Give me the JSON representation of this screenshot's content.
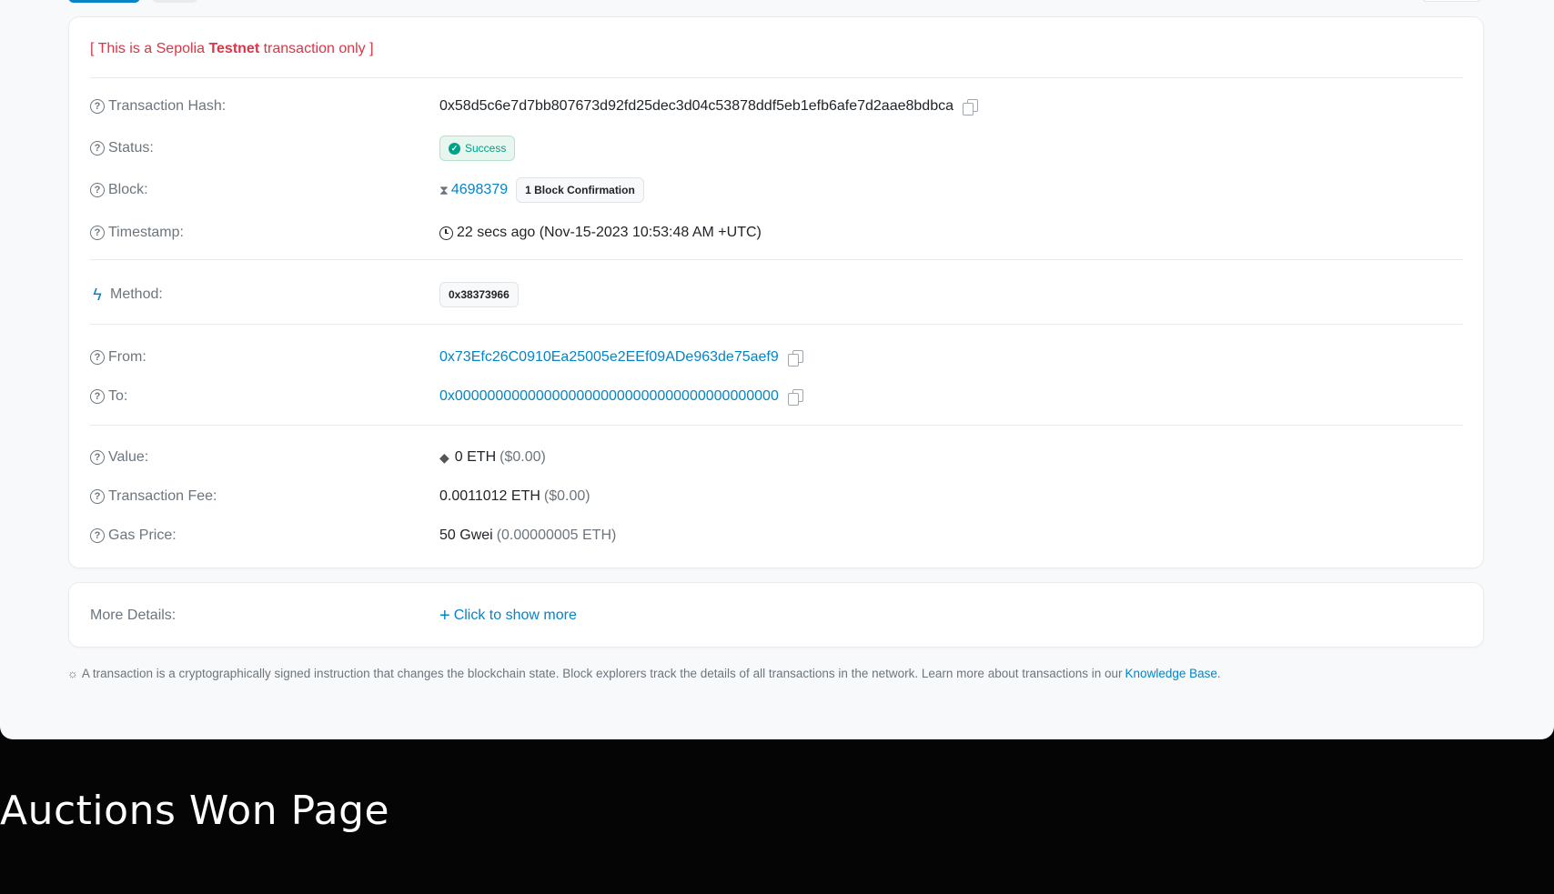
{
  "notice": {
    "open": "[ This is a Sepolia ",
    "bold": "Testnet",
    "close": " transaction only ]"
  },
  "fields": {
    "tx_hash": {
      "label": "Transaction Hash:",
      "value": "0x58d5c6e7d7bb807673d92fd25dec3d04c53878ddf5eb1efb6afe7d2aae8bdbca"
    },
    "status": {
      "label": "Status:",
      "value": "Success"
    },
    "block": {
      "label": "Block:",
      "number": "4698379",
      "confirmations": "1 Block Confirmation"
    },
    "timestamp": {
      "label": "Timestamp:",
      "value": "22 secs ago (Nov-15-2023 10:53:48 AM +UTC)"
    },
    "method": {
      "label": "Method:",
      "value": "0x38373966"
    },
    "from": {
      "label": "From:",
      "value": "0x73Efc26C0910Ea25005e2EEf09ADe963de75aef9"
    },
    "to": {
      "label": "To:",
      "value": "0x0000000000000000000000000000000000000000"
    },
    "value": {
      "label": "Value:",
      "amount": "0 ETH",
      "usd": "($0.00)"
    },
    "fee": {
      "label": "Transaction Fee:",
      "amount": "0.0011012 ETH",
      "usd": "($0.00)"
    },
    "gas": {
      "label": "Gas Price:",
      "amount": "50 Gwei",
      "eth": "(0.00000005 ETH)"
    }
  },
  "more_details": {
    "label": "More Details:",
    "link": "Click to show more"
  },
  "footnote": {
    "text": "A transaction is a cryptographically signed instruction that changes the blockchain state. Block explorers track the details of all transactions in the network. Learn more about transactions in our ",
    "link": "Knowledge Base",
    "end": "."
  },
  "caption": "Auctions Won Page",
  "icons": {
    "question": "question-circle-icon",
    "copy": "copy-icon",
    "check": "check-circle-icon",
    "hourglass": "hourglass-icon",
    "clock": "clock-icon",
    "bolt": "lightning-icon",
    "eth": "ethereum-icon",
    "plus": "plus-icon",
    "bulb": "lightbulb-icon"
  },
  "colors": {
    "accent": "#0784c3",
    "danger": "#dc3545",
    "success": "#00a186",
    "muted": "#6c757d",
    "text": "#212529"
  }
}
